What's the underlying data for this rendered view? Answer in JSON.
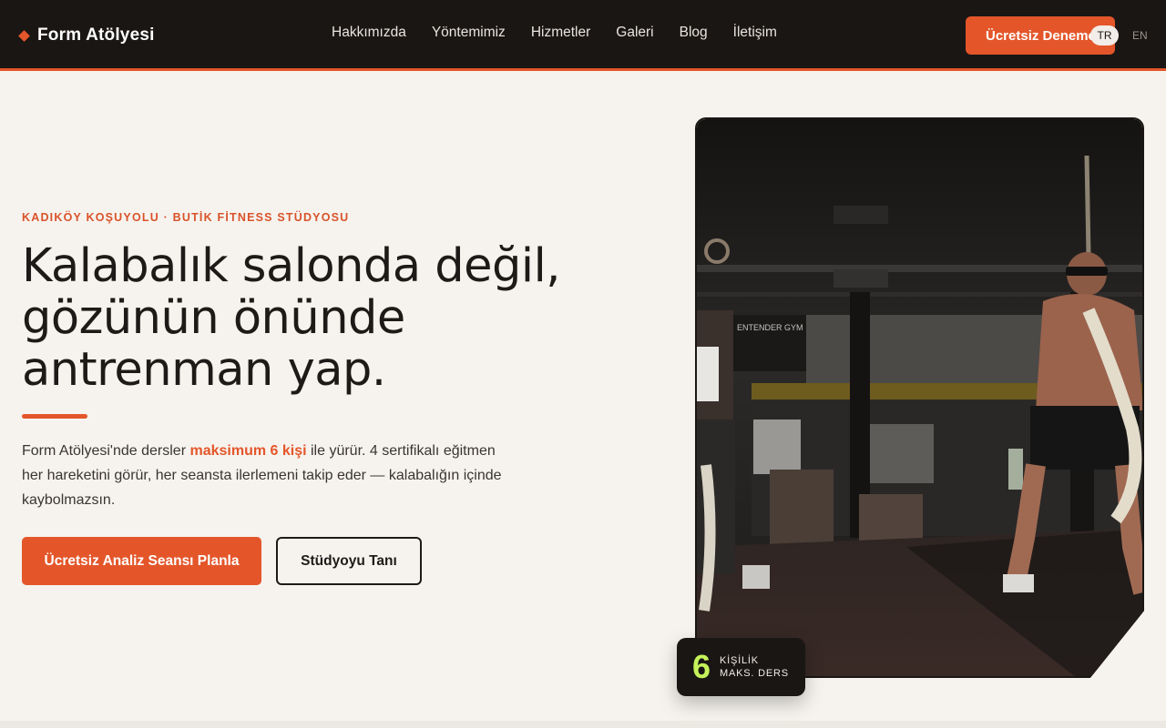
{
  "brand": {
    "name": "Form Atölyesi",
    "accent": "#e4562a",
    "dark": "#1a1614",
    "highlight": "#c5f25a"
  },
  "nav": {
    "items": [
      "Hakkımızda",
      "Yöntemimiz",
      "Hizmetler",
      "Galeri",
      "Blog",
      "İletişim"
    ],
    "cta": "Ücretsiz Deneme",
    "lang_active": "TR",
    "lang_other": "EN"
  },
  "hero": {
    "eyebrow": "KADIKÖY KOŞUYOLU · BUTİK FİTNESS STÜDYOSU",
    "headline": "Kalabalık salonda değil, gözünün önünde antrenman yap.",
    "lead_before": "Form Atölyesi'nde dersler ",
    "lead_highlight": "maksimum 6 kişi",
    "lead_after": " ile yürür. 4 sertifikalı eğitmen her hareketini görür, her seansta ilerlemeni takip eder — kalabalığın içinde kaybolmazsın.",
    "primary_cta": "Ücretsiz Analiz Seansı Planla",
    "secondary_cta": "Stüdyoyu Tanı",
    "photo_sign_text": "ENTENDER GYM",
    "badge": {
      "number": "6",
      "line1": "KİŞİLİK",
      "line2": "MAKS. DERS"
    }
  }
}
